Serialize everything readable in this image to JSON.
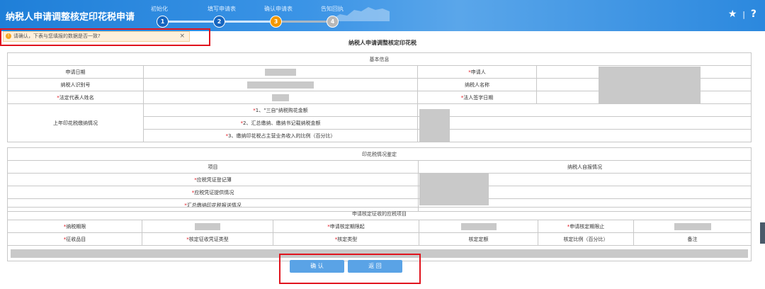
{
  "header": {
    "title": "纳税人申请调整核定印花税申请",
    "steps": [
      {
        "label": "初始化",
        "num": "1"
      },
      {
        "label": "填写申请表",
        "num": "2"
      },
      {
        "label": "确认申请表",
        "num": "3"
      },
      {
        "label": "告知回执",
        "num": "4"
      }
    ],
    "star": "★",
    "sep": "|",
    "help": "?"
  },
  "alert": {
    "icon": "!",
    "text": "请确认，下表与您填报的数据是否一致?",
    "close": "×"
  },
  "form_title": "纳税人申请调整核定印花税",
  "basic": {
    "section": "基本信息",
    "apply_date": "申请日期",
    "applicant": "申请人",
    "taxpayer_id": "纳税人识别号",
    "taxpayer_name": "纳税人名称",
    "legal_rep": "法定代表人姓名",
    "legal_sign_date": "法人签字日期",
    "last_year": "上年印花税缴纳情况",
    "items": [
      "1、\"三自\"纳税购花金额",
      "2、汇总缴纳、缴纳书记载纳税金额",
      "3、缴纳印花税占主营业务收入的比例（百分比）"
    ],
    "req": "*"
  },
  "stamp": {
    "section": "印花税情况鉴定",
    "col_item": "项目",
    "col_self": "纳税人自报情况",
    "rows": [
      "应税凭证登记薄",
      "应税凭证提供情况",
      "汇总缴纳印花税报送情况"
    ]
  },
  "apply": {
    "section": "申请核定征收的应税项目",
    "period": "纳税期限",
    "start": "申请核定期限起",
    "end": "申请核定期限止",
    "item": "征收品目",
    "voucher": "核定征收凭证类型",
    "type": "核定类型",
    "amount": "核定定额",
    "ratio": "核定比例（百分比）",
    "note": "备注"
  },
  "buttons": {
    "confirm": "确 认",
    "back": "返 回"
  }
}
